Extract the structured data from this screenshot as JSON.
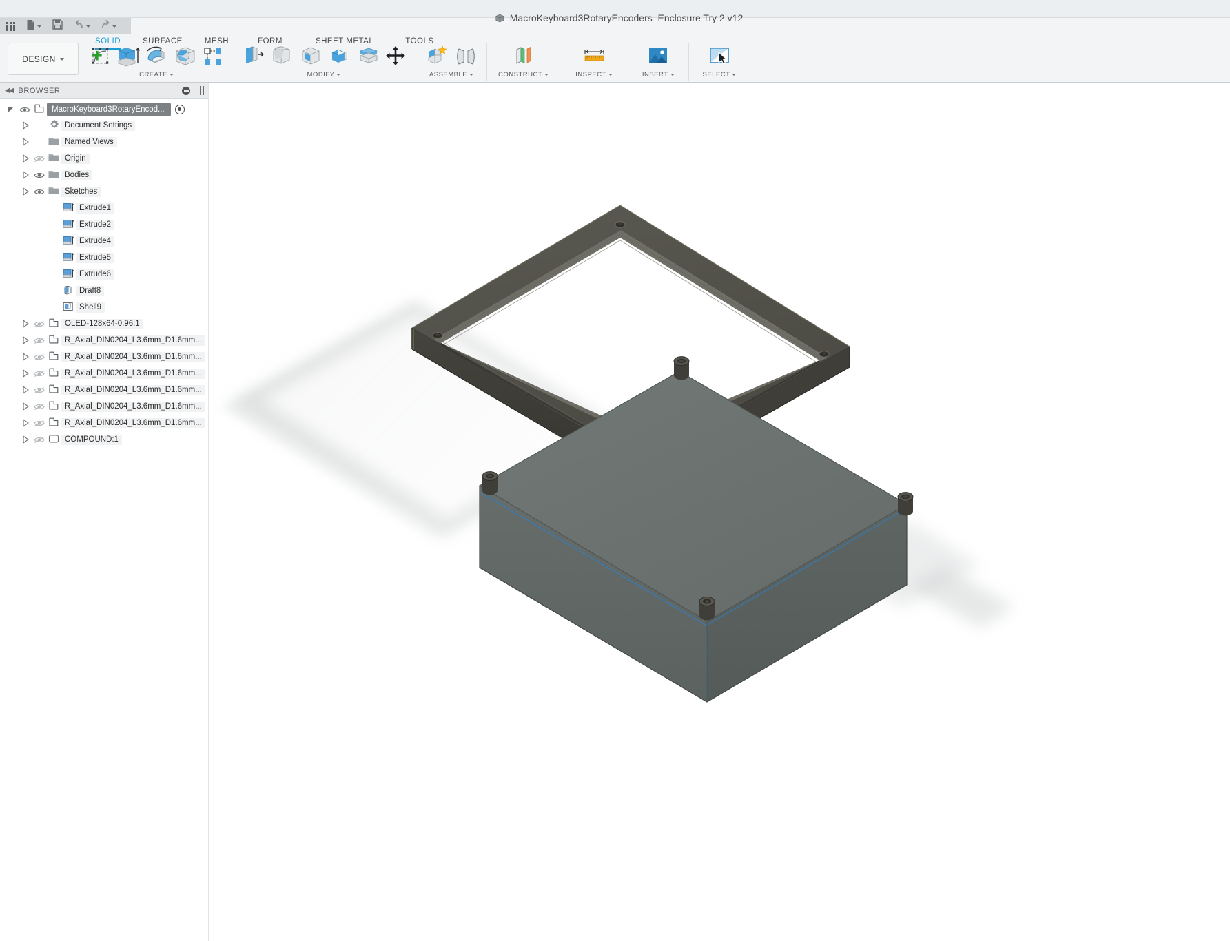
{
  "app": {
    "document_title": "MacroKeyboard3RotaryEncoders_Enclosure Try 2 v12",
    "document_icon": "component-cube-icon"
  },
  "quick_access": {
    "items": [
      {
        "name": "app-grid",
        "icon": "grid-icon",
        "label": ""
      },
      {
        "name": "new-file",
        "icon": "file-icon",
        "label": ""
      },
      {
        "name": "save",
        "icon": "save-icon",
        "label": ""
      },
      {
        "name": "undo",
        "icon": "undo-arrow-icon",
        "label": ""
      },
      {
        "name": "redo",
        "icon": "redo-arrow-icon",
        "label": ""
      }
    ]
  },
  "workspace": {
    "selector_label": "DESIGN"
  },
  "ribbon": {
    "tabs": [
      {
        "label": "SOLID",
        "active": true
      },
      {
        "label": "SURFACE",
        "active": false
      },
      {
        "label": "MESH",
        "active": false
      },
      {
        "label": "FORM",
        "active": false
      },
      {
        "label": "SHEET METAL",
        "active": false
      },
      {
        "label": "TOOLS",
        "active": false
      }
    ],
    "panels": [
      {
        "label": "CREATE",
        "has_dropdown": true,
        "tools": [
          {
            "name": "create-sketch",
            "icon": "sketch-plus-icon"
          },
          {
            "name": "extrude",
            "icon": "extrude-icon"
          },
          {
            "name": "revolve",
            "icon": "revolve-icon"
          },
          {
            "name": "hole",
            "icon": "hole-icon"
          },
          {
            "name": "pattern",
            "icon": "pattern-icon"
          }
        ]
      },
      {
        "label": "MODIFY",
        "has_dropdown": true,
        "tools": [
          {
            "name": "press-pull",
            "icon": "press-pull-icon"
          },
          {
            "name": "fillet",
            "icon": "fillet-icon"
          },
          {
            "name": "shell",
            "icon": "shell-icon"
          },
          {
            "name": "combine",
            "icon": "combine-icon"
          },
          {
            "name": "split-face",
            "icon": "split-face-icon"
          },
          {
            "name": "move-copy",
            "icon": "move-arrows-icon"
          }
        ]
      },
      {
        "label": "ASSEMBLE",
        "has_dropdown": true,
        "tools": [
          {
            "name": "new-component",
            "icon": "new-component-star-icon"
          },
          {
            "name": "joint",
            "icon": "joint-icon"
          }
        ]
      },
      {
        "label": "CONSTRUCT",
        "has_dropdown": true,
        "tools": [
          {
            "name": "offset-plane",
            "icon": "offset-plane-icon"
          }
        ]
      },
      {
        "label": "INSPECT",
        "has_dropdown": true,
        "tools": [
          {
            "name": "measure",
            "icon": "ruler-measure-icon"
          }
        ]
      },
      {
        "label": "INSERT",
        "has_dropdown": true,
        "tools": [
          {
            "name": "insert-mcmaster",
            "icon": "insert-image-icon"
          }
        ]
      },
      {
        "label": "SELECT",
        "has_dropdown": true,
        "tools": [
          {
            "name": "select",
            "icon": "select-cursor-icon"
          }
        ]
      }
    ]
  },
  "browser": {
    "title": "BROWSER",
    "collapse_icon": "double-left-chevron-icon",
    "minimize_icon": "minus-circle-icon",
    "tree": [
      {
        "label": "MacroKeyboard3RotaryEncod...",
        "icon": "component-icon",
        "expander": true,
        "eye": "visible",
        "root": true,
        "indent": 0,
        "radio": true
      },
      {
        "label": "Document Settings",
        "icon": "gear-icon",
        "expander": true,
        "eye": "none",
        "indent": 1
      },
      {
        "label": "Named Views",
        "icon": "folder-icon",
        "expander": true,
        "eye": "none",
        "indent": 1
      },
      {
        "label": "Origin",
        "icon": "folder-icon",
        "expander": true,
        "eye": "hidden",
        "indent": 1
      },
      {
        "label": "Bodies",
        "icon": "folder-icon",
        "expander": true,
        "eye": "visible",
        "indent": 1
      },
      {
        "label": "Sketches",
        "icon": "folder-icon",
        "expander": true,
        "eye": "visible",
        "indent": 1
      },
      {
        "label": "Extrude1",
        "icon": "extrude-feature-icon",
        "expander": false,
        "eye": "none",
        "indent": 2
      },
      {
        "label": "Extrude2",
        "icon": "extrude-feature-icon",
        "expander": false,
        "eye": "none",
        "indent": 2
      },
      {
        "label": "Extrude4",
        "icon": "extrude-feature-icon",
        "expander": false,
        "eye": "none",
        "indent": 2
      },
      {
        "label": "Extrude5",
        "icon": "extrude-feature-icon",
        "expander": false,
        "eye": "none",
        "indent": 2
      },
      {
        "label": "Extrude6",
        "icon": "extrude-feature-icon",
        "expander": false,
        "eye": "none",
        "indent": 2
      },
      {
        "label": "Draft8",
        "icon": "draft-feature-icon",
        "expander": false,
        "eye": "none",
        "indent": 2
      },
      {
        "label": "Shell9",
        "icon": "shell-feature-icon",
        "expander": false,
        "eye": "none",
        "indent": 2
      },
      {
        "label": "OLED-128x64-0.96:1",
        "icon": "component-icon",
        "expander": true,
        "eye": "hidden",
        "indent": 1
      },
      {
        "label": "R_Axial_DIN0204_L3.6mm_D1.6mm...",
        "icon": "component-icon",
        "expander": true,
        "eye": "hidden",
        "indent": 1
      },
      {
        "label": "R_Axial_DIN0204_L3.6mm_D1.6mm...",
        "icon": "component-icon",
        "expander": true,
        "eye": "hidden",
        "indent": 1
      },
      {
        "label": "R_Axial_DIN0204_L3.6mm_D1.6mm...",
        "icon": "component-icon",
        "expander": true,
        "eye": "hidden",
        "indent": 1
      },
      {
        "label": "R_Axial_DIN0204_L3.6mm_D1.6mm...",
        "icon": "component-icon",
        "expander": true,
        "eye": "hidden",
        "indent": 1
      },
      {
        "label": "R_Axial_DIN0204_L3.6mm_D1.6mm...",
        "icon": "component-icon",
        "expander": true,
        "eye": "hidden",
        "indent": 1
      },
      {
        "label": "R_Axial_DIN0204_L3.6mm_D1.6mm...",
        "icon": "component-icon",
        "expander": true,
        "eye": "hidden",
        "indent": 1
      },
      {
        "label": "COMPOUND:1",
        "icon": "body-icon",
        "expander": true,
        "eye": "hidden",
        "indent": 1
      }
    ]
  },
  "canvas": {
    "description": "3D isometric view of an enclosure: a dark grey rectangular frame (lid rim) floating upper-left and a solid grey box body lower-right with four corner screw bosses",
    "parts": [
      {
        "name": "enclosure-frame",
        "color": "#4f4e47"
      },
      {
        "name": "enclosure-body",
        "color": "#6d7472"
      }
    ]
  },
  "colors": {
    "accent": "#1a9cd8",
    "ribbon_bg": "#f3f4f5",
    "qab_bg": "#d4d7d9",
    "titlebar_bg": "#eceff1",
    "tree_highlight": "#7e8184",
    "frame_part": "#4f4e47",
    "body_part": "#6d7472",
    "sketch_line": "#3a7fbf"
  }
}
